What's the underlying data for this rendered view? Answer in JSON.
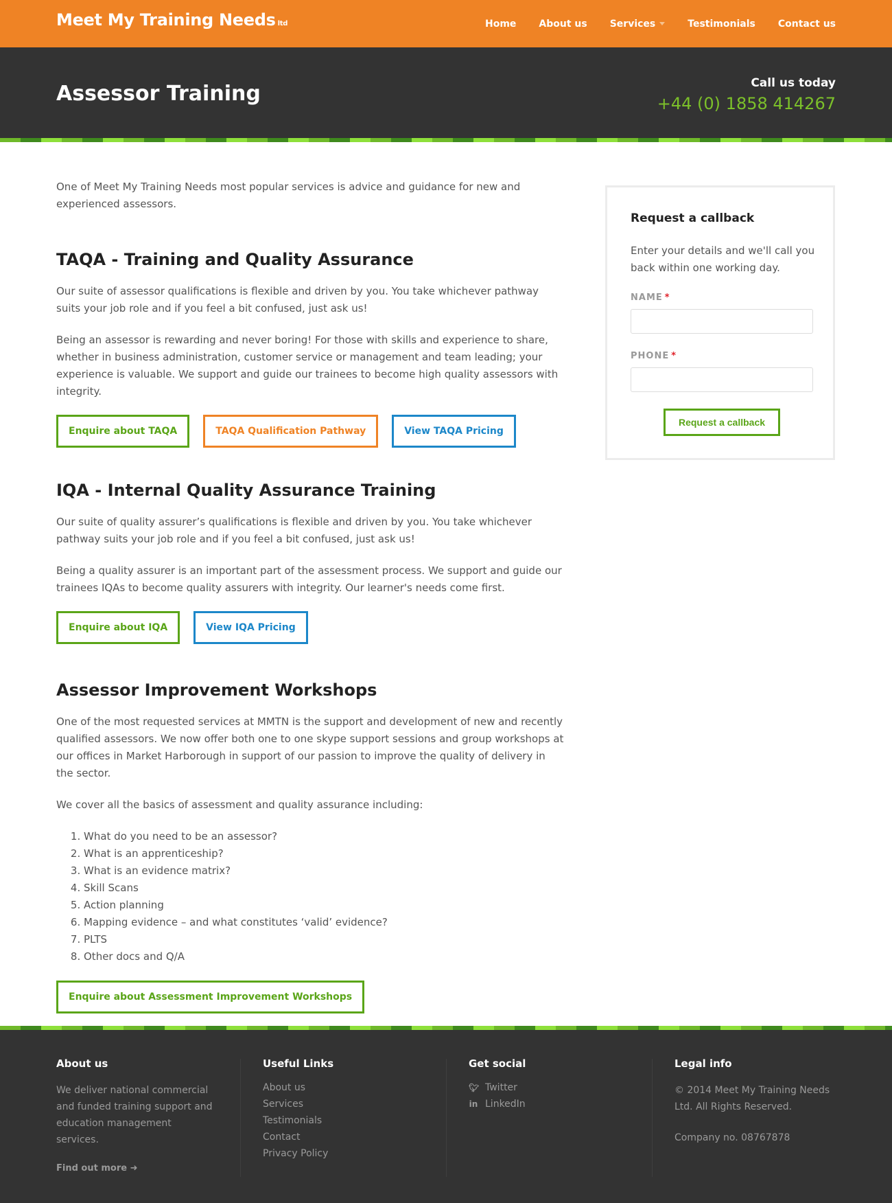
{
  "brand": {
    "name": "Meet My Training Needs",
    "suffix": "ltd"
  },
  "nav": {
    "items": [
      "Home",
      "About us",
      "Services",
      "Testimonials",
      "Contact us"
    ]
  },
  "hero": {
    "title": "Assessor Training",
    "call_label": "Call us today",
    "phone": "+44 (0) 1858 414267"
  },
  "main": {
    "intro": "One of Meet My Training Needs most popular services is advice and guidance for new and experienced assessors.",
    "taqa": {
      "heading": "TAQA - Training and Quality Assurance",
      "p1": "Our suite of assessor qualifications is flexible and driven by you. You take whichever pathway suits your job role and if you feel a bit confused, just ask us!",
      "p2": "Being an assessor is rewarding and never boring! For those with skills and experience to share, whether in business administration, customer service or management and team leading; your experience is valuable. We support and guide our trainees to become high quality assessors with integrity.",
      "btn_enquire": "Enquire about TAQA",
      "btn_pathway": "TAQA Qualification Pathway",
      "btn_pricing": "View TAQA Pricing"
    },
    "iqa": {
      "heading": "IQA - Internal Quality Assurance Training",
      "p1": "Our suite of quality assurer’s qualifications is flexible and driven by you. You take whichever pathway suits your job role and if you feel a bit confused, just ask us!",
      "p2": "Being a quality assurer is an important part of the assessment process. We support and guide our trainees IQAs to become quality assurers with integrity. Our learner's needs come first.",
      "btn_enquire": "Enquire about IQA",
      "btn_pricing": "View IQA Pricing"
    },
    "workshops": {
      "heading": "Assessor Improvement Workshops",
      "p1": "One of the most requested services at MMTN is the support and development of new and recently qualified assessors. We now offer both one to one skype support sessions and group workshops at our offices in Market Harborough in support of our passion to improve the quality of delivery in the sector.",
      "p2": "We cover all the basics of assessment and quality assurance including:",
      "list": [
        "What do you need to be an assessor?",
        "What is an apprenticeship?",
        "What is an evidence matrix?",
        "Skill Scans",
        "Action planning",
        "Mapping evidence – and what constitutes ‘valid’ evidence?",
        "PLTS",
        "Other docs and Q/A"
      ],
      "btn_enquire": "Enquire about Assessment Improvement Workshops"
    }
  },
  "callback": {
    "title": "Request a callback",
    "text": "Enter your details and we'll call you back within one working day.",
    "name_label": "NAME",
    "phone_label": "PHONE",
    "required_mark": "*",
    "name_value": "",
    "phone_value": "",
    "submit": "Request a callback"
  },
  "footer": {
    "about": {
      "heading": "About us",
      "text": "We deliver national commercial and funded training support and education management services.",
      "link": "Find out more"
    },
    "links": {
      "heading": "Useful Links",
      "items": [
        "About us",
        "Services",
        "Testimonials",
        "Contact",
        "Privacy Policy"
      ]
    },
    "social": {
      "heading": "Get social",
      "items": [
        {
          "label": "Twitter",
          "icon": "twitter-icon"
        },
        {
          "label": "LinkedIn",
          "icon": "linkedin-icon"
        }
      ]
    },
    "legal": {
      "heading": "Legal info",
      "copyright": "© 2014 Meet My Training Needs Ltd. All Rights Reserved.",
      "company": "Company no. 08767878"
    }
  },
  "colors": {
    "brand_orange": "#ef8325",
    "dark": "#333333",
    "green": "#5aa518",
    "blue": "#1c87c9",
    "phone_green": "#7cc02a"
  }
}
